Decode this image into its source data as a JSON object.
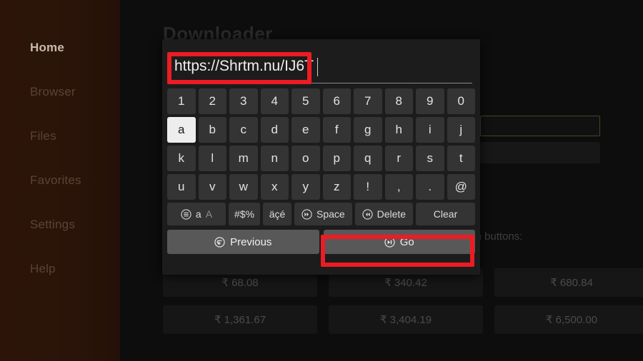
{
  "sidebar": {
    "items": [
      {
        "label": "Home",
        "state": "active"
      },
      {
        "label": "Browser",
        "state": "dim"
      },
      {
        "label": "Files",
        "state": "dim"
      },
      {
        "label": "Favorites",
        "state": "dim"
      },
      {
        "label": "Settings",
        "state": "dim"
      },
      {
        "label": "Help",
        "state": "dim"
      }
    ]
  },
  "background": {
    "app_title": "Downloader",
    "note_line1": "ase donation buttons:",
    "note_line2": ")",
    "amounts": [
      "₹ 68.08",
      "₹ 340.42",
      "₹ 680.84",
      "₹ 1,361.67",
      "₹ 3,404.19",
      "₹ 6,500.00"
    ]
  },
  "keyboard_dialog": {
    "url_value": "https://Shrtm.nu/IJ6T",
    "url_placeholder": "",
    "rows": [
      [
        "1",
        "2",
        "3",
        "4",
        "5",
        "6",
        "7",
        "8",
        "9",
        "0"
      ],
      [
        "a",
        "b",
        "c",
        "d",
        "e",
        "f",
        "g",
        "h",
        "i",
        "j"
      ],
      [
        "k",
        "l",
        "m",
        "n",
        "o",
        "p",
        "q",
        "r",
        "s",
        "t"
      ],
      [
        "u",
        "v",
        "w",
        "x",
        "y",
        "z",
        "!",
        ",",
        ".",
        "@"
      ]
    ],
    "selected_key": "a",
    "function_keys": {
      "case_primary": "a",
      "case_secondary": "A",
      "symbols": "#$%",
      "accents": "äçé",
      "space": "Space",
      "delete": "Delete",
      "clear": "Clear"
    },
    "actions": {
      "previous": "Previous",
      "go": "Go"
    }
  },
  "annotations": {
    "highlight_color": "#ec1c24",
    "boxes": [
      "url-field",
      "go-button"
    ]
  }
}
